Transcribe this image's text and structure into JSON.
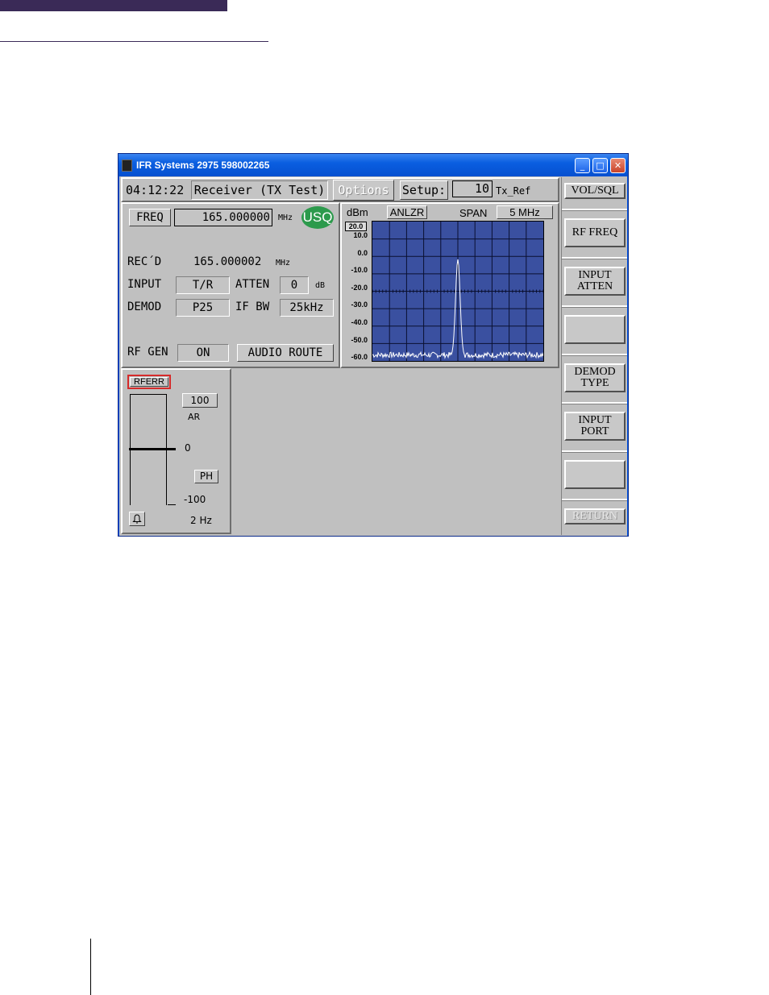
{
  "window": {
    "title": "IFR Systems 2975 598002265",
    "controls": {
      "minimize": "_",
      "maximize": "□",
      "close": "✕"
    }
  },
  "toolbar": {
    "time": "04:12:22",
    "mode": "Receiver (TX Test)",
    "options": "Options",
    "setup_label": "Setup:",
    "setup_value": "10",
    "setup_name": "Tx_Ref"
  },
  "receiver": {
    "freq_label": "FREQ",
    "freq_value": "165.000000",
    "freq_unit": "MHz",
    "squelch_badge": "USQ",
    "recd_label": "REC´D",
    "recd_value": "165.000002",
    "recd_unit": "MHz",
    "input_label": "INPUT",
    "input_value": "T/R",
    "atten_label": "ATTEN",
    "atten_value": "0",
    "atten_unit": "dB",
    "demod_label": "DEMOD",
    "demod_value": "P25",
    "ifbw_label": "IF BW",
    "ifbw_value": "25kHz",
    "rfgen_label": "RF GEN",
    "rfgen_value": "ON",
    "audio_route": "AUDIO ROUTE"
  },
  "analyzer": {
    "unit": "dBm",
    "mode": "ANLZR",
    "span_label": "SPAN",
    "span_value": "5 MHz",
    "ref_box": "20.0",
    "y_ticks": [
      "10.0",
      "0.0",
      "-10.0",
      "-20.0",
      "-30.0",
      "-40.0",
      "-50.0",
      "-60.0"
    ],
    "colors": {
      "screen": "#3a50a0",
      "trace": "#ffffff",
      "grid": "#0a1030"
    }
  },
  "meter": {
    "title": "RFERR",
    "top_value": "100",
    "ar_label": "AR",
    "zero_label": "0",
    "ph_button": "PH",
    "bottom_value": "-100",
    "rate": "2 Hz",
    "alarm_icon": "bell-icon",
    "needle_level": 0
  },
  "softkeys": [
    {
      "label": "VOL/SQL",
      "enabled": true
    },
    {
      "label": "RF FREQ",
      "enabled": true
    },
    {
      "label": "INPUT\nATTEN",
      "enabled": true
    },
    {
      "label": "",
      "enabled": true
    },
    {
      "label": "DEMOD\nTYPE",
      "enabled": true
    },
    {
      "label": "INPUT\nPORT",
      "enabled": true
    },
    {
      "label": "",
      "enabled": true
    },
    {
      "label": "RETURN",
      "enabled": false
    }
  ]
}
